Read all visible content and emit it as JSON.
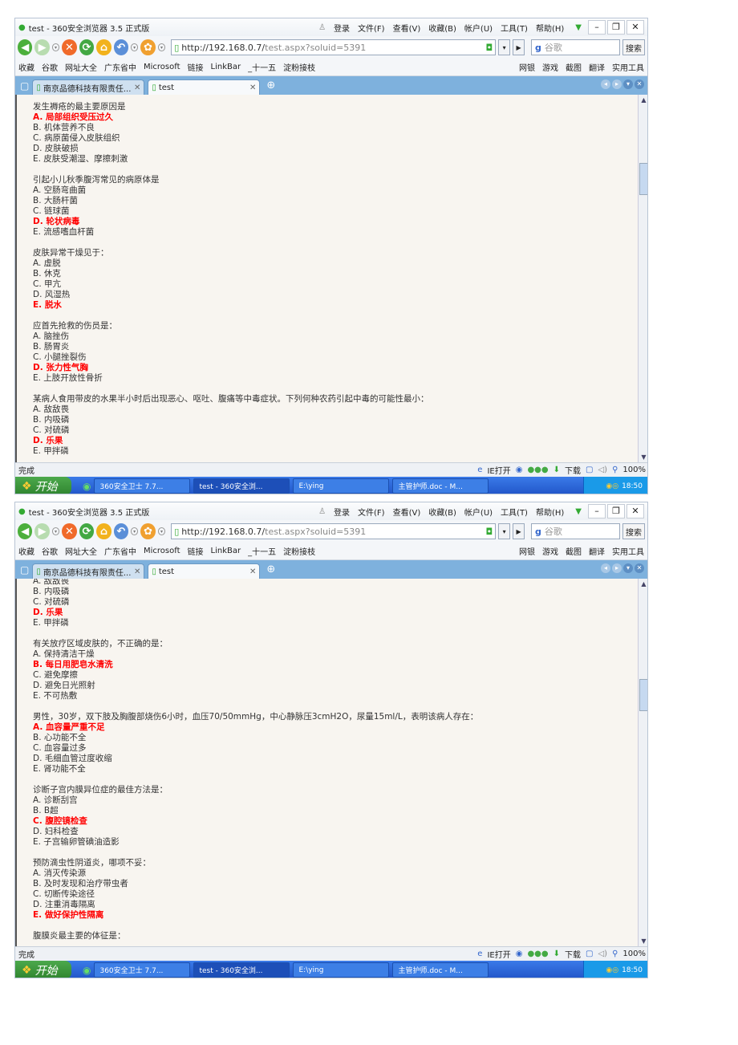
{
  "browser": {
    "title": "test - 360安全浏览器 3.5 正式版",
    "menu": [
      "登录",
      "文件(F)",
      "查看(V)",
      "收藏(B)",
      "帐户(U)",
      "工具(T)",
      "帮助(H)"
    ],
    "url_host": "http://192.168.0.7/",
    "url_path": "test.aspx?soluid=5391",
    "search_placeholder": "谷歌",
    "search_button": "搜索",
    "favorites": [
      "收藏",
      "谷歌",
      "网址大全",
      "广东省中",
      "Microsoft",
      "链接",
      "LinkBar",
      "_十一五",
      "淀粉接枝"
    ],
    "tools": [
      "网银",
      "游戏",
      "截图",
      "翻译",
      "实用工具"
    ],
    "tabs": [
      "南京品德科技有限责任...",
      "test"
    ],
    "status_text": "完成",
    "status_items": [
      "IE打开",
      "下载",
      "100%"
    ],
    "taskbar": {
      "start": "开始",
      "items": [
        "360安全卫士 7.7...",
        "test - 360安全浏...",
        "E:\\ying",
        "主管护师.doc - M..."
      ],
      "clock": "18:50"
    },
    "colors": {
      "answer": "#ff0000",
      "tab_bar": "#7eb1dd",
      "taskbar": "#2459d0"
    }
  },
  "windows": [
    {
      "lines": [
        {
          "text": "发生褥疮的最主要原因是"
        },
        {
          "text": "A. 局部组织受压过久",
          "answer": true
        },
        {
          "text": "B. 机体营养不良"
        },
        {
          "text": "C. 病原菌侵入皮肤组织"
        },
        {
          "text": "D. 皮肤破损"
        },
        {
          "text": "E. 皮肤受潮湿、摩擦刺激"
        },
        {
          "text": ""
        },
        {
          "text": "引起小儿秋季腹泻常见的病原体是"
        },
        {
          "text": "A. 空肠弯曲菌"
        },
        {
          "text": "B. 大肠杆菌"
        },
        {
          "text": "C. 链球菌"
        },
        {
          "text": "D. 轮状病毒",
          "answer": true
        },
        {
          "text": "E. 流感嗜血杆菌"
        },
        {
          "text": ""
        },
        {
          "text": "皮肤异常干燥见于："
        },
        {
          "text": "A. 虚脱"
        },
        {
          "text": "B. 休克"
        },
        {
          "text": "C. 甲亢"
        },
        {
          "text": "D. 风湿热"
        },
        {
          "text": "E. 脱水",
          "answer": true
        },
        {
          "text": ""
        },
        {
          "text": "应首先抢救的伤员是："
        },
        {
          "text": "A. 脑挫伤"
        },
        {
          "text": "B. 肠胃炎"
        },
        {
          "text": "C. 小腿挫裂伤"
        },
        {
          "text": "D. 张力性气胸",
          "answer": true
        },
        {
          "text": "E. 上肢开放性骨折"
        },
        {
          "text": ""
        },
        {
          "text": "某病人食用带皮的水果半小时后出现恶心、呕吐、腹痛等中毒症状。下列何种农药引起中毒的可能性最小："
        },
        {
          "text": "A. 敌敌畏"
        },
        {
          "text": "B. 内吸磷"
        },
        {
          "text": "C. 对硫磷"
        },
        {
          "text": "D. 乐果",
          "answer": true
        },
        {
          "text": "E. 甲拌磷"
        }
      ]
    },
    {
      "lines": [
        {
          "text": "A. 敌敌畏"
        },
        {
          "text": "B. 内吸磷"
        },
        {
          "text": "C. 对硫磷"
        },
        {
          "text": "D. 乐果",
          "answer": true
        },
        {
          "text": "E. 甲拌磷"
        },
        {
          "text": ""
        },
        {
          "text": "有关放疗区域皮肤的，不正确的是："
        },
        {
          "text": "A. 保持清洁干燥"
        },
        {
          "text": "B. 每日用肥皂水清洗",
          "answer": true
        },
        {
          "text": "C. 避免摩擦"
        },
        {
          "text": "D. 避免日光照射"
        },
        {
          "text": "E. 不可热敷"
        },
        {
          "text": ""
        },
        {
          "text": "男性，30岁，双下肢及胸腹部烧伤6小时，血压70/50mmHg，中心静脉压3cmH2O，尿量15ml/L，表明该病人存在："
        },
        {
          "text": "A. 血容量严重不足",
          "answer": true
        },
        {
          "text": "B. 心功能不全"
        },
        {
          "text": "C. 血容量过多"
        },
        {
          "text": "D. 毛细血管过度收缩"
        },
        {
          "text": "E. 肾功能不全"
        },
        {
          "text": ""
        },
        {
          "text": "诊断子宫内膜异位症的最佳方法是："
        },
        {
          "text": "A. 诊断刮宫"
        },
        {
          "text": "B. B超"
        },
        {
          "text": "C. 腹腔镜检查",
          "answer": true
        },
        {
          "text": "D. 妇科检查"
        },
        {
          "text": "E. 子宫输卵管碘油造影"
        },
        {
          "text": ""
        },
        {
          "text": "预防滴虫性阴道炎，哪项不妥："
        },
        {
          "text": "A. 消灭传染源"
        },
        {
          "text": "B. 及时发现和治疗带虫者"
        },
        {
          "text": "C. 切断传染途径"
        },
        {
          "text": "D. 注重消毒隔离"
        },
        {
          "text": "E. 做好保护性隔离",
          "answer": true
        },
        {
          "text": ""
        },
        {
          "text": "腹膜炎最主要的体征是："
        }
      ]
    }
  ]
}
